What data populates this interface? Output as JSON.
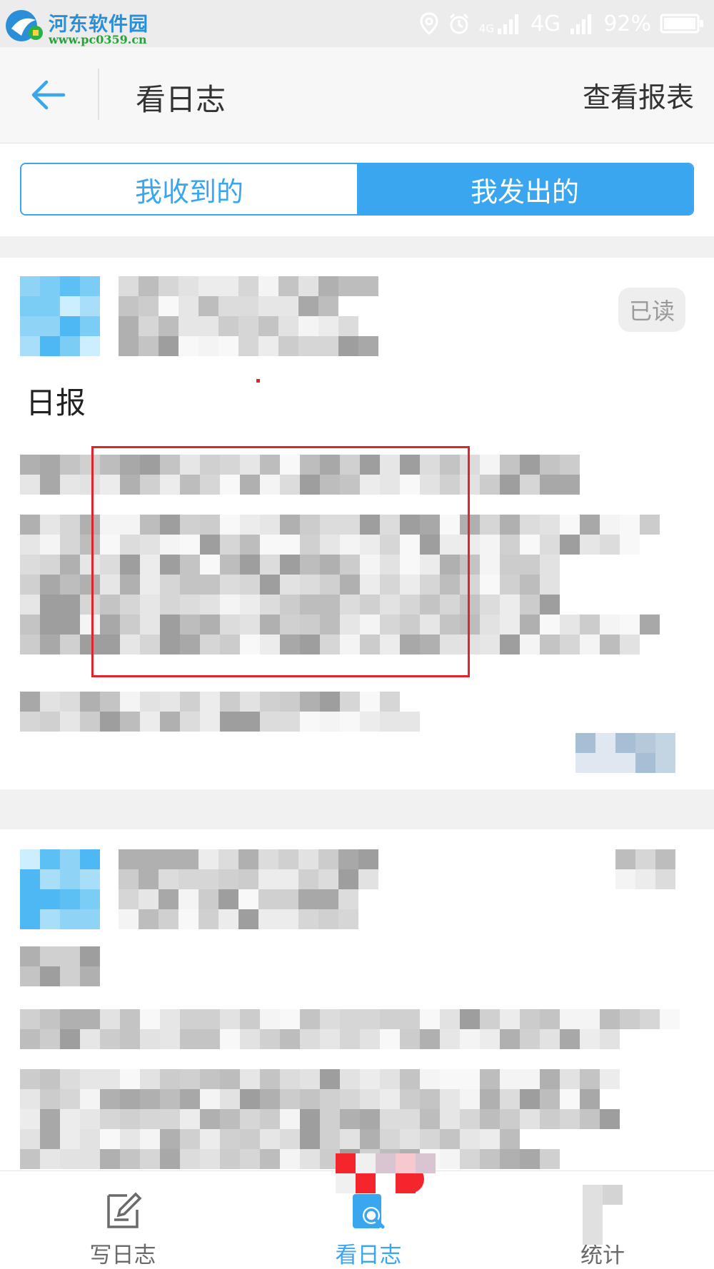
{
  "status_bar": {
    "network_small": "4G",
    "network": "4G",
    "battery": "92%",
    "icons": [
      "location-icon",
      "alarm-icon",
      "signal-icon",
      "battery-icon"
    ]
  },
  "watermark": {
    "name": "河东软件园",
    "url": "www.pc0359.cn"
  },
  "header": {
    "title": "看日志",
    "action": "查看报表",
    "back_icon": "arrow-left-icon"
  },
  "tabs": {
    "received": "我收到的",
    "sent": "我发出的",
    "active": "sent"
  },
  "cards": [
    {
      "status": "已读",
      "title": "日报"
    }
  ],
  "bottom_nav": {
    "items": [
      {
        "label": "写日志",
        "icon": "edit-log-icon"
      },
      {
        "label": "看日志",
        "icon": "view-log-icon"
      },
      {
        "label": "统计",
        "icon": "stats-icon"
      }
    ],
    "active_index": 1
  },
  "colors": {
    "accent": "#3aa6f0",
    "highlight": "#e0242c",
    "badge": "#f5252d"
  }
}
